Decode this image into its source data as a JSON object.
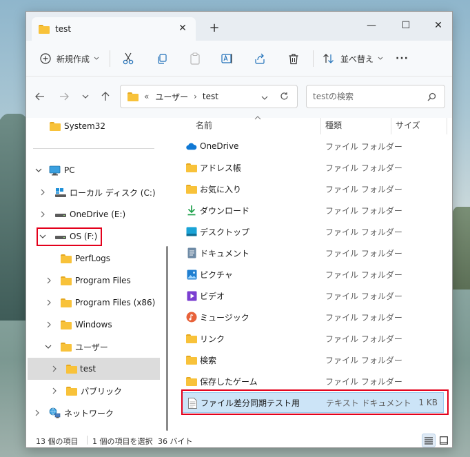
{
  "window": {
    "tab_title": "test",
    "tab_close": "✕",
    "new_tab": "+",
    "minimize": "—",
    "maximize": "☐",
    "close": "✕"
  },
  "toolbar": {
    "new_label": "新規作成",
    "sort_label": "並べ替え",
    "more_label": "···"
  },
  "address": {
    "prefix": "«",
    "segments": [
      "ユーザー",
      "test"
    ],
    "separator": "›"
  },
  "search": {
    "placeholder": "testの検索"
  },
  "sidebar": {
    "items": [
      {
        "label": "System32",
        "icon": "folder-icon"
      },
      {
        "label": "PC",
        "icon": "pc-icon"
      },
      {
        "label": "ローカル ディスク (C:)",
        "icon": "drive-icon"
      },
      {
        "label": "OneDrive (E:)",
        "icon": "drive-icon"
      },
      {
        "label": "OS (F:)",
        "icon": "drive-icon"
      },
      {
        "label": "PerfLogs",
        "icon": "folder-icon"
      },
      {
        "label": "Program Files",
        "icon": "folder-icon"
      },
      {
        "label": "Program Files (x86)",
        "icon": "folder-icon"
      },
      {
        "label": "Windows",
        "icon": "folder-icon"
      },
      {
        "label": "ユーザー",
        "icon": "folder-icon"
      },
      {
        "label": "test",
        "icon": "folder-icon"
      },
      {
        "label": "パブリック",
        "icon": "folder-icon"
      },
      {
        "label": "ネットワーク",
        "icon": "network-icon"
      }
    ]
  },
  "columns": {
    "name": "名前",
    "type": "種類",
    "size": "サイズ"
  },
  "files": [
    {
      "name": "OneDrive",
      "type": "ファイル フォルダー",
      "size": "",
      "icon": "onedrive-icon"
    },
    {
      "name": "アドレス帳",
      "type": "ファイル フォルダー",
      "size": "",
      "icon": "folder-icon"
    },
    {
      "name": "お気に入り",
      "type": "ファイル フォルダー",
      "size": "",
      "icon": "folder-icon"
    },
    {
      "name": "ダウンロード",
      "type": "ファイル フォルダー",
      "size": "",
      "icon": "download-icon"
    },
    {
      "name": "デスクトップ",
      "type": "ファイル フォルダー",
      "size": "",
      "icon": "desktop-icon"
    },
    {
      "name": "ドキュメント",
      "type": "ファイル フォルダー",
      "size": "",
      "icon": "document-icon"
    },
    {
      "name": "ピクチャ",
      "type": "ファイル フォルダー",
      "size": "",
      "icon": "pictures-icon"
    },
    {
      "name": "ビデオ",
      "type": "ファイル フォルダー",
      "size": "",
      "icon": "video-icon"
    },
    {
      "name": "ミュージック",
      "type": "ファイル フォルダー",
      "size": "",
      "icon": "music-icon"
    },
    {
      "name": "リンク",
      "type": "ファイル フォルダー",
      "size": "",
      "icon": "folder-icon"
    },
    {
      "name": "検索",
      "type": "ファイル フォルダー",
      "size": "",
      "icon": "folder-icon"
    },
    {
      "name": "保存したゲーム",
      "type": "ファイル フォルダー",
      "size": "",
      "icon": "folder-icon"
    },
    {
      "name": "ファイル差分同期テスト用",
      "type": "テキスト ドキュメント",
      "size": "1 KB",
      "icon": "text-file-icon"
    }
  ],
  "status": {
    "count": "13 個の項目",
    "selection": "1 個の項目を選択",
    "size": "36 バイト"
  },
  "colors": {
    "selection_bg": "#cce4f7",
    "highlight_box": "#e3001b",
    "folder": "#f8c23a"
  }
}
